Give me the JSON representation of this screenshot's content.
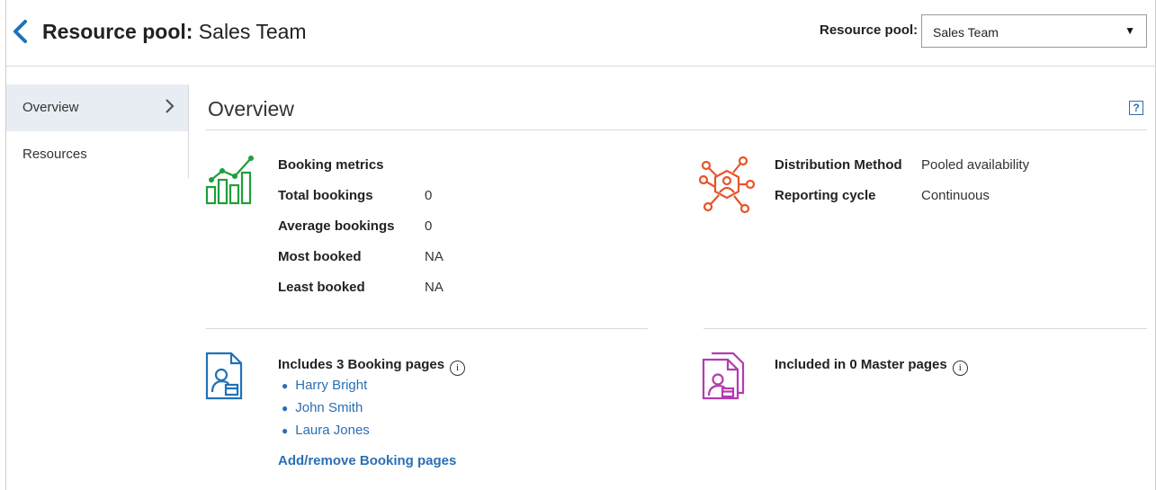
{
  "header": {
    "title_bold": "Resource pool:",
    "title_rest": " Sales Team",
    "pool_label": "Resource pool:",
    "pool_selected": "Sales Team"
  },
  "sidebar": {
    "items": [
      {
        "label": "Overview",
        "active": true
      },
      {
        "label": "Resources",
        "active": false
      }
    ]
  },
  "main": {
    "title": "Overview",
    "help_label": "?",
    "metrics": {
      "heading": "Booking metrics",
      "rows": [
        {
          "key": "Total bookings",
          "value": "0"
        },
        {
          "key": "Average bookings",
          "value": "0"
        },
        {
          "key": "Most booked",
          "value": "NA"
        },
        {
          "key": "Least booked",
          "value": "NA"
        }
      ]
    },
    "distribution": {
      "rows": [
        {
          "key": "Distribution Method",
          "value": "Pooled availability"
        },
        {
          "key": "Reporting cycle",
          "value": "Continuous"
        }
      ]
    },
    "booking_pages": {
      "title": "Includes 3 Booking pages",
      "info": "i",
      "items": [
        "Harry Bright",
        "John Smith",
        "Laura Jones"
      ],
      "add_label": "Add/remove Booking pages"
    },
    "master_pages": {
      "title": "Included in 0 Master pages",
      "info": "i"
    }
  },
  "colors": {
    "accent": "#2a6fb5",
    "metrics_icon": "#1f9e3a",
    "distribution_icon": "#e8542a",
    "booking_icon": "#1f72b8",
    "master_icon": "#b43bb0",
    "active_bg": "#e8edf3"
  },
  "icons": {
    "back": "chevron-left-icon",
    "dropdown": "caret-down-icon",
    "sidebar_chevron": "chevron-right-icon",
    "help": "help-icon",
    "metrics": "bar-chart-icon",
    "distribution": "network-hub-icon",
    "booking_page": "booking-page-icon",
    "master_page": "master-pages-icon",
    "info": "info-icon"
  }
}
